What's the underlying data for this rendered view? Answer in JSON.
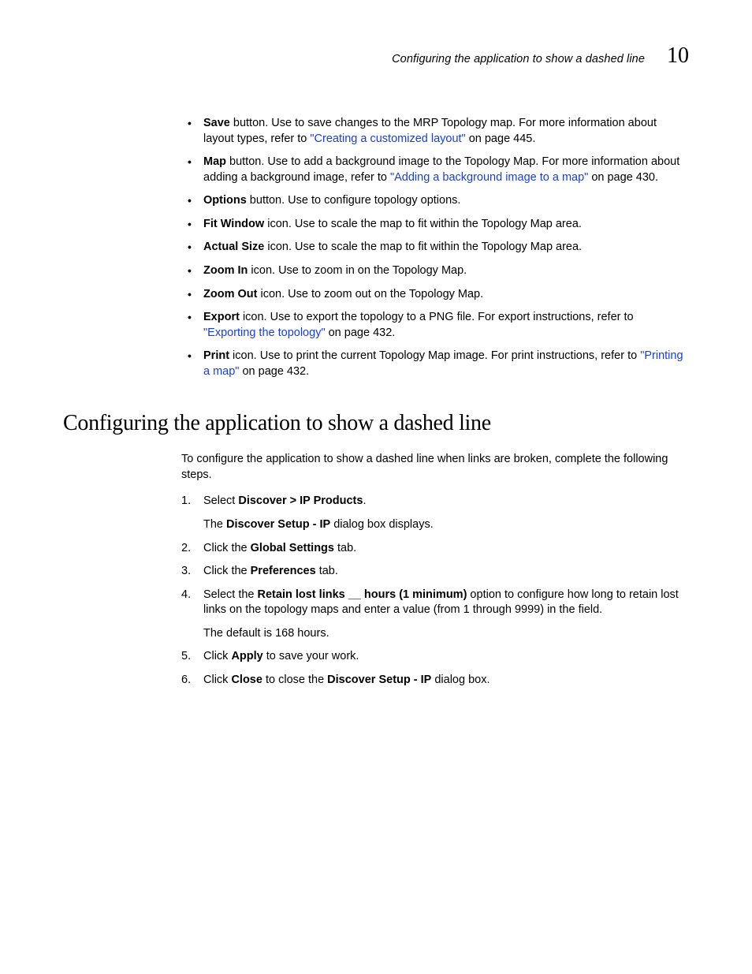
{
  "header": {
    "running_title": "Configuring the application to show a dashed line",
    "chapter_number": "10"
  },
  "bullets": {
    "save": {
      "label": "Save",
      "text_before_link": " button. Use to save changes to the MRP Topology map. For more information about layout types, refer to ",
      "link": "\"Creating a customized layout\"",
      "text_after_link": " on page 445."
    },
    "map": {
      "label": "Map",
      "text_before_link": " button. Use to add a background image to the Topology Map. For more information about adding a background image, refer to ",
      "link": "\"Adding a background image to a map\"",
      "text_after_link": " on page 430."
    },
    "options": {
      "label": "Options",
      "text": " button. Use to configure topology options."
    },
    "fit_window": {
      "label": "Fit Window",
      "text": " icon. Use to scale the map to fit within the Topology Map area."
    },
    "actual_size": {
      "label": "Actual Size",
      "text": " icon. Use to scale the map to fit within the Topology Map area."
    },
    "zoom_in": {
      "label": "Zoom In",
      "text": " icon. Use to zoom in on the Topology Map."
    },
    "zoom_out": {
      "label": "Zoom Out",
      "text": " icon. Use to zoom out on the Topology Map."
    },
    "export": {
      "label": "Export",
      "text_before_link": " icon. Use to export the topology to a PNG file. For export instructions, refer to ",
      "link": "\"Exporting the topology\"",
      "text_after_link": " on page 432."
    },
    "print": {
      "label": "Print",
      "text_before_link": " icon. Use to print the current Topology Map image. For print instructions, refer to ",
      "link": "\"Printing a map\"",
      "text_after_link": " on page 432."
    }
  },
  "section": {
    "heading": "Configuring the application to show a dashed line",
    "intro": "To configure the application to show a dashed line when links are broken, complete the following steps."
  },
  "steps": {
    "s1": {
      "pre": "Select ",
      "bold": "Discover > IP Products",
      "post": ".",
      "sub_pre": "The ",
      "sub_bold": "Discover Setup - IP",
      "sub_post": " dialog box displays."
    },
    "s2": {
      "pre": "Click the ",
      "bold": "Global Settings",
      "post": " tab."
    },
    "s3": {
      "pre": "Click the ",
      "bold": "Preferences",
      "post": " tab."
    },
    "s4": {
      "pre": "Select the ",
      "bold": "Retain lost links __ hours (1 minimum)",
      "post": " option to configure how long to retain lost links on the topology maps and enter a value (from 1 through 9999) in the field.",
      "sub": "The default is 168 hours."
    },
    "s5": {
      "pre": "Click ",
      "bold": "Apply",
      "post": " to save your work."
    },
    "s6": {
      "pre": "Click ",
      "bold1": "Close",
      "mid": " to close the ",
      "bold2": "Discover Setup - IP",
      "post": " dialog box."
    }
  }
}
